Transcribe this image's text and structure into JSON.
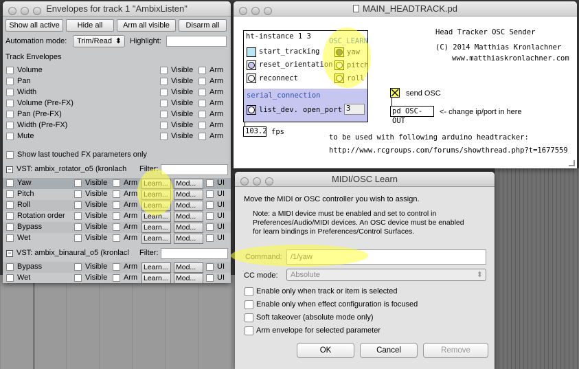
{
  "envelopes_window": {
    "title": "Envelopes for track 1 \"AmbixListen\"",
    "buttons": [
      "Show all active",
      "Hide all",
      "Arm all visible",
      "Disarm all"
    ],
    "automation_mode_label": "Automation mode:",
    "automation_mode_value": "Trim/Read",
    "highlight_label": "Highlight:",
    "track_envelopes_label": "Track Envelopes",
    "visible_label": "Visible",
    "arm_label": "Arm",
    "ui_label": "UI",
    "learn_label": "Learn...",
    "mod_label": "Mod...",
    "track_envelopes": [
      "Volume",
      "Pan",
      "Width",
      "Volume (Pre-FX)",
      "Pan (Pre-FX)",
      "Width (Pre-FX)",
      "Mute"
    ],
    "show_last_touched": "Show last touched FX parameters only",
    "vst1_title": "VST: ambix_rotator_o5 (kronlach",
    "vst1_filter_label": "Filter:",
    "vst1_params": [
      "Yaw",
      "Pitch",
      "Roll",
      "Rotation order",
      "Bypass",
      "Wet"
    ],
    "vst2_title": "VST: ambix_binaural_o5 (kronlacl",
    "vst2_filter_label": "Filter:",
    "vst2_params": [
      "Bypass",
      "Wet"
    ]
  },
  "pd_window": {
    "title": "MAIN_HEADTRACK.pd",
    "ht_instance": "ht-instance 1 3",
    "osc_learn": "OSC_LEARN",
    "left_labels": [
      "start_tracking",
      "reset_orientation",
      "reconnect"
    ],
    "right_labels": [
      "yaw",
      "pitch",
      "roll"
    ],
    "serial_connection": "serial_connection",
    "list_dev": "list_dev.",
    "open_port": "open_port",
    "open_port_value": "3",
    "fps_value": "103.2",
    "fps_label": "fps",
    "send_osc_label": "send OSC",
    "pd_osc_out": "pd OSC-OUT",
    "change_hint": "<- change ip/port in here",
    "header_lines": [
      "Head Tracker OSC Sender",
      "(C) 2014 Matthias Kronlachner",
      "www.matthiaskronlachner.com"
    ],
    "usage_line": "to be used with following arduino headtracker:",
    "url_line": "http://www.rcgroups.com/forums/showthread.php?t=1677559"
  },
  "learn_dialog": {
    "title": "MIDI/OSC Learn",
    "instruction": "Move the MIDI or OSC controller you wish to assign.",
    "note_line1": "Note: a MIDI device must be enabled and set to control in",
    "note_line2": "Preferences/Audio/MIDI devices. An OSC device must be enabled",
    "note_line3": "for learn bindings in Preferences/Control Surfaces.",
    "command_label": "Command:",
    "command_value": "/1/yaw",
    "cc_mode_label": "CC mode:",
    "cc_mode_value": "Absolute",
    "options": [
      "Enable only when track or item is selected",
      "Enable only when effect configuration is focused",
      "Soft takeover (absolute mode only)",
      "Arm envelope for selected parameter"
    ],
    "ok": "OK",
    "cancel": "Cancel",
    "remove": "Remove"
  },
  "colors": {
    "highlight": "#ffff3c",
    "pd_selection": "#c6c6f0",
    "pd_toggle_fill": "#ffff5a",
    "pd_bang_cyan": "#b8e8f8"
  }
}
